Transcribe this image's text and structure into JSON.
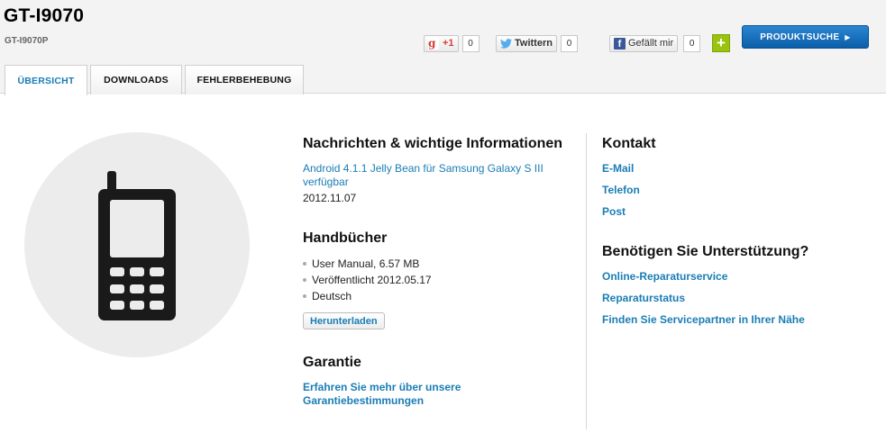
{
  "header": {
    "model_title": "GT-I9070",
    "model_sub": "GT-I9070P"
  },
  "social": {
    "gplus": {
      "label": "+1",
      "count": "0"
    },
    "twitter": {
      "label": "Twittern",
      "count": "0"
    },
    "facebook": {
      "label": "Gefällt mir",
      "count": "0"
    },
    "plus_label": "+"
  },
  "produktsuche": {
    "label": "PRODUKTSUCHE",
    "arrow": "▶"
  },
  "tabs": [
    {
      "label": "ÜBERSICHT",
      "active": true
    },
    {
      "label": "DOWNLOADS",
      "active": false
    },
    {
      "label": "FEHLERBEHEBUNG",
      "active": false
    }
  ],
  "news": {
    "title": "Nachrichten & wichtige Informationen",
    "link_line1": "Android 4.1.1 Jelly Bean für Samsung Galaxy S III",
    "link_line2": "verfügbar",
    "date": "2012.11.07"
  },
  "manuals": {
    "title": "Handbücher",
    "items": [
      "User Manual, 6.57 MB",
      "Veröffentlicht 2012.05.17",
      "Deutsch"
    ],
    "download_label": "Herunterladen"
  },
  "warranty": {
    "title": "Garantie",
    "link_line1": "Erfahren Sie mehr über unsere",
    "link_line2": "Garantiebestimmungen"
  },
  "contact": {
    "title": "Kontakt",
    "links": [
      "E-Mail",
      "Telefon",
      "Post"
    ]
  },
  "support": {
    "title": "Benötigen Sie Unterstützung?",
    "links": [
      "Online-Reparaturservice",
      "Reparaturstatus",
      "Finden Sie Servicepartner in Ihrer Nähe"
    ]
  },
  "colors": {
    "link": "#1a7db5",
    "primary_button": "#0b5ea8",
    "plus_button": "#9ac30d",
    "facebook": "#3b5998",
    "twitter": "#55acee",
    "gplus": "#d73d32"
  }
}
